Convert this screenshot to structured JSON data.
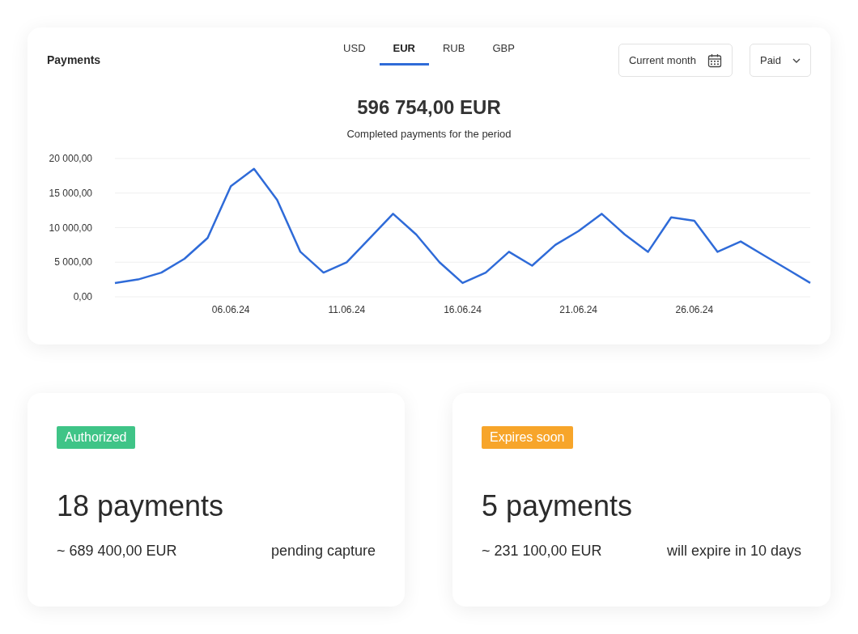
{
  "header": {
    "title": "Payments",
    "currency_tabs": [
      {
        "label": "USD",
        "selected": false
      },
      {
        "label": "EUR",
        "selected": true
      },
      {
        "label": "RUB",
        "selected": false
      },
      {
        "label": "GBP",
        "selected": false
      }
    ],
    "period_button": {
      "label": "Current month"
    },
    "status_dropdown": {
      "value": "Paid"
    }
  },
  "total": {
    "amount": "596 754,00 EUR",
    "caption": "Completed payments for the period"
  },
  "chart_data": {
    "type": "line",
    "categories": [
      null,
      null,
      null,
      null,
      null,
      "06.06.24",
      null,
      null,
      null,
      null,
      "11.06.24",
      null,
      null,
      null,
      null,
      "16.06.24",
      null,
      null,
      null,
      null,
      "21.06.24",
      null,
      null,
      null,
      null,
      "26.06.24",
      null,
      null,
      null,
      null,
      null
    ],
    "series": [
      {
        "color": "#2f6bd8",
        "values": [
          2000,
          2500,
          3500,
          5500,
          8500,
          16000,
          18500,
          14000,
          6500,
          3500,
          5000,
          8500,
          12000,
          9000,
          5000,
          2000,
          3500,
          6500,
          4500,
          7500,
          9500,
          12000,
          9000,
          6500,
          11500,
          11000,
          6500,
          8000,
          6000,
          4000,
          2000
        ]
      }
    ],
    "ylim": [
      0,
      20000
    ],
    "grid": true,
    "yticks": [
      {
        "value": 0,
        "label": "0,00"
      },
      {
        "value": 5000,
        "label": "5 000,00"
      },
      {
        "value": 10000,
        "label": "10 000,00"
      },
      {
        "value": 15000,
        "label": "15 000,00"
      },
      {
        "value": 20000,
        "label": "20 000,00"
      }
    ]
  },
  "summary_cards": [
    {
      "tag": "Authorized",
      "color": "#3fc487",
      "count": "18 payments",
      "amount": "~ 689 400,00 EUR",
      "note": "pending capture"
    },
    {
      "tag": "Expires soon",
      "color": "#f7a52a",
      "count": "5 payments",
      "amount": "~ 231 100,00 EUR",
      "note": "will expire in 10 days"
    }
  ]
}
